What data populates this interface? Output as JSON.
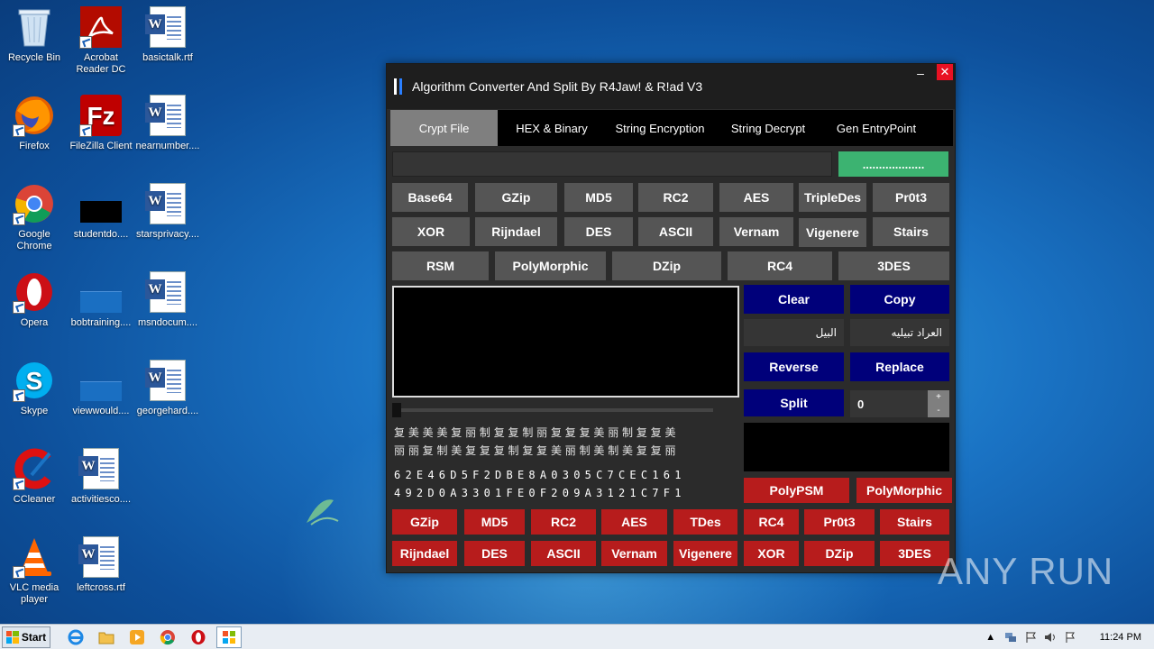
{
  "desktop": {
    "icons": [
      {
        "label": "Recycle Bin"
      },
      {
        "label": "Acrobat Reader DC"
      },
      {
        "label": "basictalk.rtf"
      },
      {
        "label": "Firefox"
      },
      {
        "label": "FileZilla Client"
      },
      {
        "label": "nearnumber...."
      },
      {
        "label": "Google Chrome"
      },
      {
        "label": "studentdo...."
      },
      {
        "label": "starsprivacy...."
      },
      {
        "label": "Opera"
      },
      {
        "label": "bobtraining...."
      },
      {
        "label": "msndocum...."
      },
      {
        "label": "Skype"
      },
      {
        "label": "viewwould...."
      },
      {
        "label": "georgehard...."
      },
      {
        "label": "CCleaner"
      },
      {
        "label": "activitiesco...."
      },
      {
        "label": "VLC media player"
      },
      {
        "label": "leftcross.rtf"
      }
    ]
  },
  "window": {
    "title": "Algorithm Converter And Split By R4Jaw! & R!ad V3",
    "minimize": "–",
    "close": "✕",
    "tabs": [
      {
        "label": "Crypt File"
      },
      {
        "label": "HEX & Binary"
      },
      {
        "label": "String Encryption"
      },
      {
        "label": "String Decrypt"
      },
      {
        "label": "Gen EntryPoint"
      }
    ],
    "key_button": "...................",
    "algo_row1": [
      "Base64",
      "GZip",
      "MD5",
      "RC2",
      "AES",
      "TripleDes",
      "Pr0t3"
    ],
    "algo_row2": [
      "XOR",
      "Rijndael",
      "DES",
      "ASCII",
      "Vernam",
      "Vigenere",
      "Stairs"
    ],
    "algo_row3": [
      "RSM",
      "PolyMorphic",
      "DZip",
      "RC4",
      "3DES"
    ],
    "clear": "Clear",
    "copy": "Copy",
    "find_value": "البيل",
    "replace_value": "العراد تبيليه",
    "reverse": "Reverse",
    "replace": "Replace",
    "split": "Split",
    "split_count": "0",
    "spin_up": "+",
    "spin_down": "-",
    "glyph_line1": "复 美 美 美 复 丽 制 复 复 制 丽 复 复 复 美 丽 制 复 复 美",
    "glyph_line2": "丽 丽 复 制 美 复 复 复 制 复 复 美 丽 制 美 制 美 复 复 丽",
    "hex_line1": "6 2 E 4 6 D 5 F 2 D B E 8 A 0 3 0 5 C 7 C E C 1 6 1",
    "hex_line2": "4 9 2 D 0 A 3 3 0 1 F E 0 F 2 0 9 A 3 1 2 1 C 7 F 1",
    "poly_psm": "PolyPSM",
    "poly_morphic": "PolyMorphic",
    "red_row1": [
      "GZip",
      "MD5",
      "RC2",
      "AES",
      "TDes",
      "RC4",
      "Pr0t3",
      "Stairs"
    ],
    "red_row2": [
      "Rijndael",
      "DES",
      "ASCII",
      "Vernam",
      "Vigenere",
      "XOR",
      "DZip",
      "3DES"
    ]
  },
  "taskbar": {
    "start": "Start",
    "clock": "11:24 PM"
  },
  "watermark": "ANY RUN"
}
